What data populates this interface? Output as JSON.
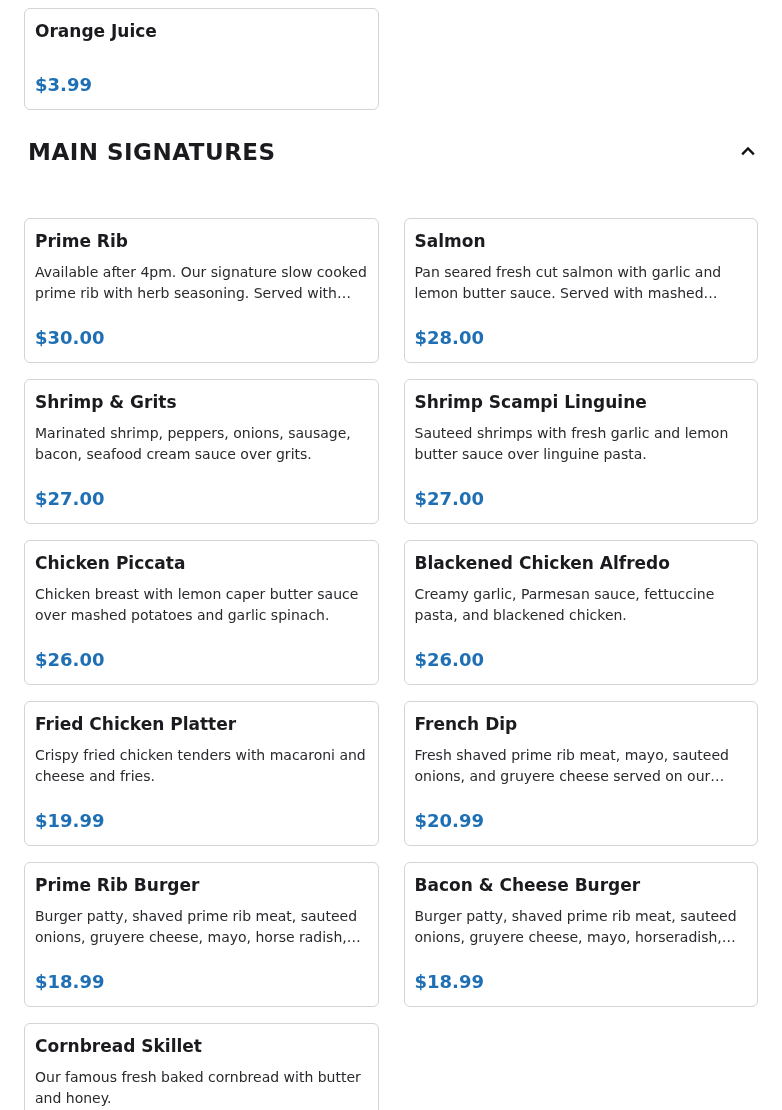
{
  "previous_items": [
    {
      "name": "Orange Juice",
      "price": "$3.99"
    }
  ],
  "section": {
    "title": "MAIN SIGNATURES",
    "expanded": true
  },
  "items": [
    {
      "name": "Prime Rib",
      "description": "Available after 4pm. Our signature slow cooked prime rib with herb seasoning. Served with…",
      "price": "$30.00"
    },
    {
      "name": "Salmon",
      "description": "Pan seared fresh cut salmon with garlic and lemon butter sauce. Served with mashed…",
      "price": "$28.00"
    },
    {
      "name": "Shrimp & Grits",
      "description": "Marinated shrimp, peppers, onions, sausage, bacon, seafood cream sauce over grits.",
      "price": "$27.00"
    },
    {
      "name": "Shrimp Scampi Linguine",
      "description": "Sauteed shrimps with fresh garlic and lemon butter sauce over linguine pasta.",
      "price": "$27.00"
    },
    {
      "name": "Chicken Piccata",
      "description": "Chicken breast with lemon caper butter sauce over mashed potatoes and garlic spinach.",
      "price": "$26.00"
    },
    {
      "name": "Blackened Chicken Alfredo",
      "description": "Creamy garlic, Parmesan sauce, fettuccine pasta, and blackened chicken.",
      "price": "$26.00"
    },
    {
      "name": "Fried Chicken Platter",
      "description": "Crispy fried chicken tenders with macaroni and cheese and fries.",
      "price": "$19.99"
    },
    {
      "name": "French Dip",
      "description": "Fresh shaved prime rib meat, mayo, sauteed onions, and gruyere cheese served on our…",
      "price": "$20.99"
    },
    {
      "name": "Prime Rib Burger",
      "description": "Burger patty, shaved prime rib meat, sauteed onions, gruyere cheese, mayo, horse radish,…",
      "price": "$18.99"
    },
    {
      "name": "Bacon & Cheese Burger",
      "description": "Burger patty, shaved prime rib meat, sauteed onions, gruyere cheese, mayo, horseradish,…",
      "price": "$18.99"
    },
    {
      "name": "Cornbread Skillet",
      "description": "Our famous fresh baked cornbread with butter and honey."
    }
  ]
}
